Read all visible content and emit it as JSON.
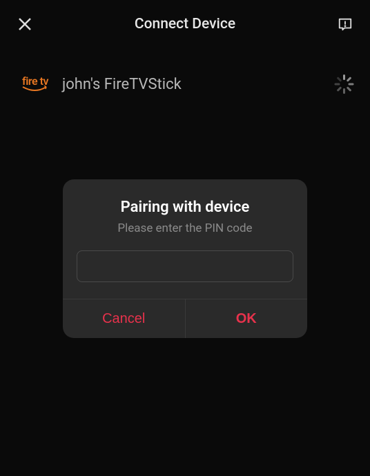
{
  "header": {
    "title": "Connect Device"
  },
  "device": {
    "logo_text": "fire tv",
    "name": "john's FireTVStick"
  },
  "modal": {
    "title": "Pairing with device",
    "subtitle": "Please enter the PIN code",
    "pin_value": "",
    "cancel_label": "Cancel",
    "ok_label": "OK"
  }
}
